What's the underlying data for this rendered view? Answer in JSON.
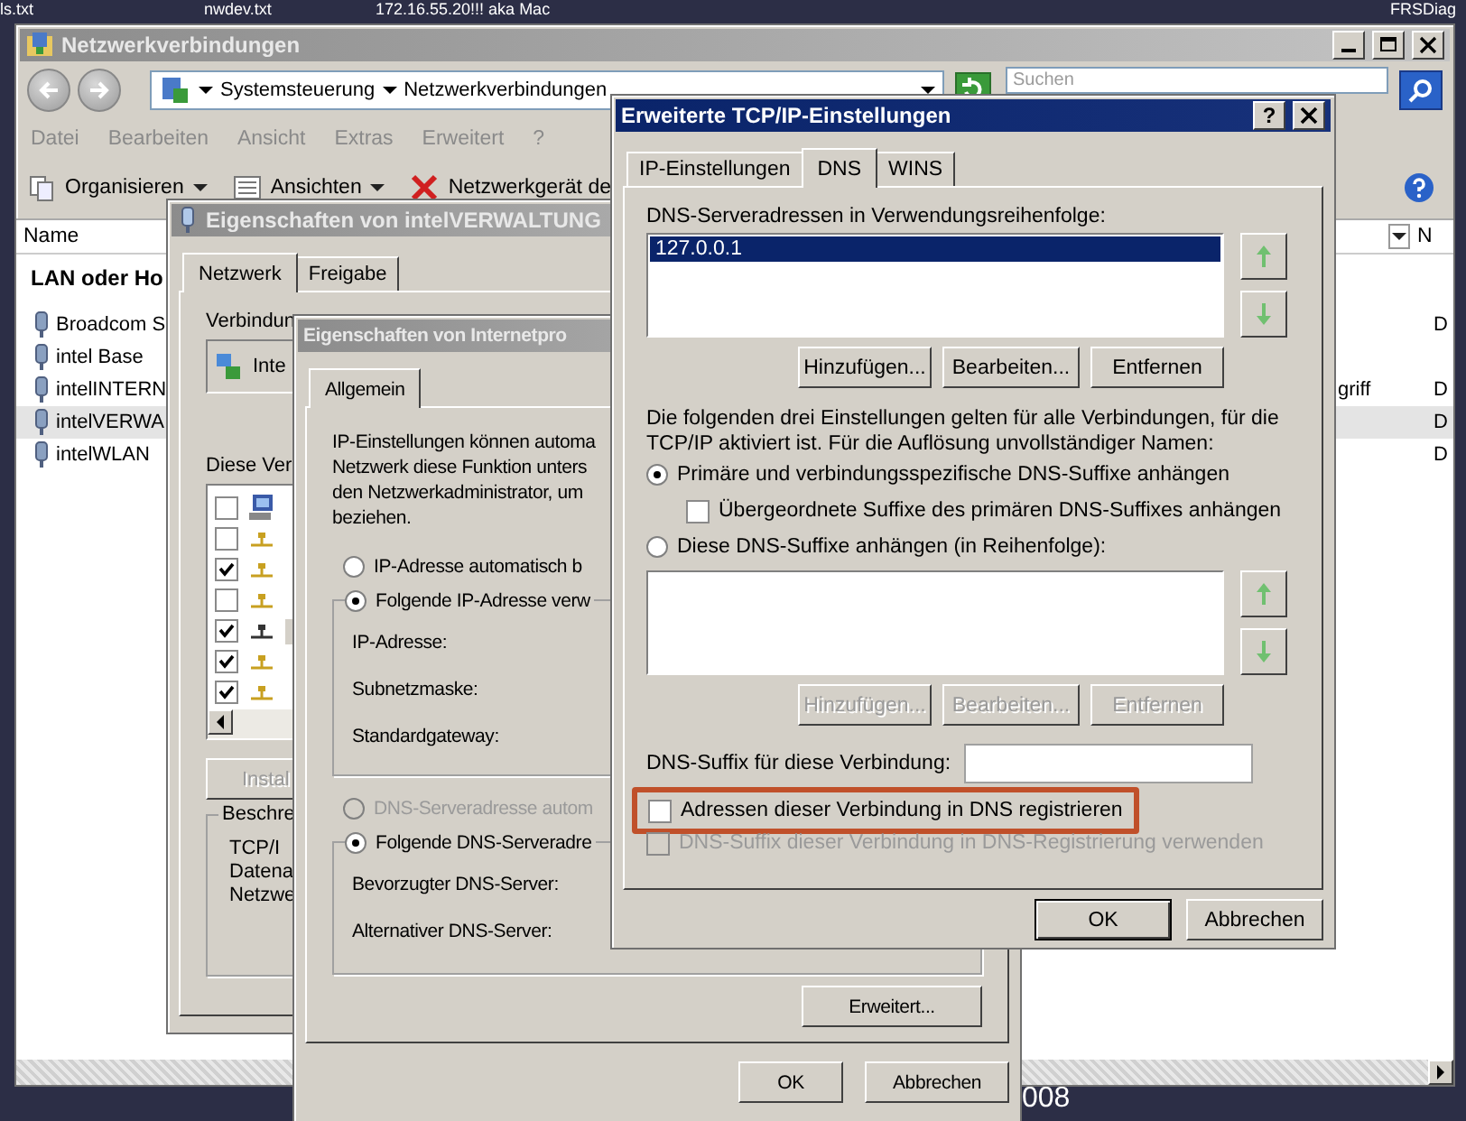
{
  "taskbar": [
    "ls.txt",
    "nwdev.txt",
    "172.16.55.20!!! aka Mac",
    "FRSDiag"
  ],
  "desktop_text": "008",
  "explorer": {
    "title": "Netzwerkverbindungen",
    "breadcrumb": [
      "Systemsteuerung",
      "Netzwerkverbindungen"
    ],
    "search": {
      "placeholder": "Suchen"
    },
    "menu": [
      "Datei",
      "Bearbeiten",
      "Ansicht",
      "Extras",
      "Erweitert",
      "?"
    ],
    "toolbar": [
      {
        "kind": "organize",
        "label": "Organisieren"
      },
      {
        "kind": "views",
        "label": "Ansichten"
      },
      {
        "kind": "delete",
        "label": "Netzwerkgerät de"
      }
    ],
    "columns": [
      "Name",
      "N"
    ],
    "group": "LAN oder Ho",
    "rows": [
      {
        "name": "Broadcom S",
        "column_3": "D",
        "selected": false
      },
      {
        "name": "intel Base",
        "selected": false
      },
      {
        "name": "intelINTERN",
        "column_2": "griff",
        "column_3": "D",
        "selected": false
      },
      {
        "name": "intelVERWA",
        "column_3": "D",
        "selected": true
      },
      {
        "name": "intelWLAN",
        "column_3": "D",
        "selected": false
      }
    ]
  },
  "adapter_properties": {
    "title": "Eigenschaften von intelVERWALTUNG",
    "tabs": [
      {
        "label": "Netzwerk",
        "selected": true
      },
      {
        "label": "Freigabe",
        "selected": false
      }
    ],
    "connect_label": "Verbindun",
    "adapter": "Inte",
    "components_label": "Diese Ver",
    "components": [
      {
        "kind": "client",
        "checked": false,
        "selected": false
      },
      {
        "kind": "protocol",
        "checked": false,
        "selected": false
      },
      {
        "kind": "protocol",
        "checked": true,
        "selected": false
      },
      {
        "kind": "protocol",
        "checked": false,
        "selected": false
      },
      {
        "kind": "protocol",
        "checked": true,
        "selected": true
      },
      {
        "kind": "protocol",
        "checked": true,
        "selected": false
      },
      {
        "kind": "protocol",
        "checked": true,
        "selected": false
      }
    ],
    "install_button": "Instal",
    "description_title": "Beschre",
    "description_lines": [
      "TCP/I",
      "Datena",
      "Netzwe"
    ]
  },
  "ipv4_properties": {
    "title": "Eigenschaften von Internetpro",
    "tabs": [
      {
        "label": "Allgemein",
        "selected": true
      }
    ],
    "intro": [
      "IP-Einstellungen können automa",
      "Netzwerk diese Funktion unters",
      "den Netzwerkadministrator, um",
      "beziehen."
    ],
    "ip_auto": {
      "label": "IP-Adresse automatisch b",
      "selected": false
    },
    "ip_manual": {
      "label": "Folgende IP-Adresse verw",
      "selected": true
    },
    "ip_fields": [
      "IP-Adresse:",
      "Subnetzmaske:",
      "Standardgateway:"
    ],
    "dns_auto": {
      "label": "DNS-Serveradresse autom",
      "selected": false,
      "disabled": true
    },
    "dns_manual": {
      "label": "Folgende DNS-Serveradre",
      "selected": true
    },
    "dns_fields": [
      "Bevorzugter DNS-Server:",
      "Alternativer DNS-Server:"
    ],
    "advanced_button": "Erweitert...",
    "buttons": [
      "OK",
      "Abbrechen"
    ]
  },
  "advanced": {
    "title": "Erweiterte TCP/IP-Einstellungen",
    "help_button": "?",
    "tabs": [
      {
        "label": "IP-Einstellungen",
        "selected": false
      },
      {
        "label": "DNS",
        "selected": true
      },
      {
        "label": "WINS",
        "selected": false
      }
    ],
    "servers_label": "DNS-Serveradressen in Verwendungsreihenfolge:",
    "servers": [
      {
        "address": "127.0.0.1",
        "selected": true
      }
    ],
    "server_buttons": [
      {
        "label": "Hinzufügen...",
        "disabled": false
      },
      {
        "label": "Bearbeiten...",
        "disabled": false
      },
      {
        "label": "Entfernen",
        "disabled": false
      }
    ],
    "info": "Die folgenden drei Einstellungen gelten für alle Verbindungen, für die TCP/IP aktiviert ist. Für die Auflösung unvollständiger Namen:",
    "append_primary": {
      "label": "Primäre und verbindungsspezifische DNS-Suffixe anhängen",
      "selected": true
    },
    "parent_suffixes": {
      "label": "Übergeordnete Suffixe des primären DNS-Suffixes anhängen",
      "checked": false
    },
    "append_list": {
      "label": "Diese DNS-Suffixe anhängen (in Reihenfolge):",
      "selected": false
    },
    "suffix_buttons": [
      {
        "label": "Hinzufügen...",
        "disabled": true
      },
      {
        "label": "Bearbeiten...",
        "disabled": true
      },
      {
        "label": "Entfernen",
        "disabled": true
      }
    ],
    "suffix_label": "DNS-Suffix für diese Verbindung:",
    "register": {
      "label": "Adressen dieser Verbindung in DNS registrieren",
      "checked": false,
      "highlighted": true
    },
    "use_suffix": {
      "label": "DNS-Suffix dieser Verbindung in DNS-Registrierung verwenden",
      "checked": false,
      "disabled": true
    },
    "buttons": [
      {
        "label": "OK",
        "default": true
      },
      {
        "label": "Abbrechen",
        "default": false
      }
    ]
  }
}
